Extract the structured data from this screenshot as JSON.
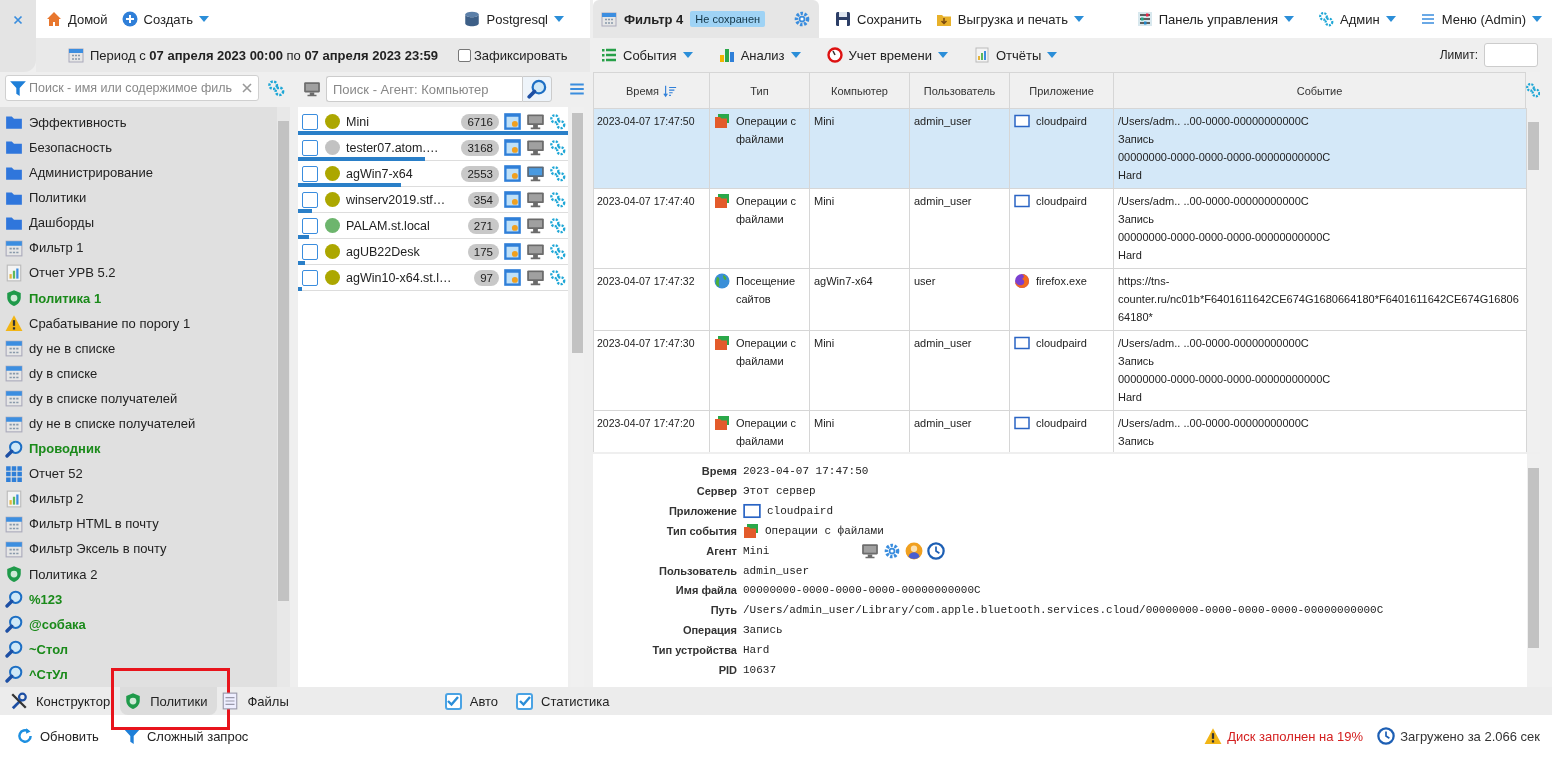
{
  "header": {
    "nav": [
      {
        "kind": "home",
        "label": "Домой",
        "dropdown": false
      },
      {
        "kind": "create",
        "label": "Создать",
        "dropdown": true
      }
    ],
    "database": {
      "label": "Postgresql",
      "dropdown": true
    },
    "period": {
      "text": "Период с **07 апреля 2023 00:00** по **07 апреля 2023 23:59**"
    },
    "fix_checkbox": {
      "label": "Зафиксировать",
      "checked": false
    },
    "document_tabs": [
      {
        "label": "Фильтр 4",
        "badge": "Не сохранен",
        "selected": true
      }
    ],
    "actions": [
      {
        "kind": "save",
        "label": "Сохранить",
        "dropdown": false
      },
      {
        "kind": "export",
        "label": "Выгрузка и печать",
        "dropdown": true
      }
    ],
    "menus": [
      {
        "kind": "panel",
        "label": "Панель управления",
        "dropdown": true
      },
      {
        "kind": "admin",
        "label": "Админ",
        "dropdown": true
      },
      {
        "kind": "menu",
        "label": "Меню (Admin)",
        "dropdown": true
      }
    ],
    "toolbar": [
      {
        "kind": "events",
        "label": "События",
        "dropdown": true
      },
      {
        "kind": "analysis",
        "label": "Анализ",
        "dropdown": true
      },
      {
        "kind": "time",
        "label": "Учет времени",
        "dropdown": true
      },
      {
        "kind": "reports",
        "label": "Отчёты",
        "dropdown": true
      }
    ],
    "limit": {
      "label": "Лимит:"
    }
  },
  "sidebar": {
    "search": {
      "placeholder": "Поиск - имя или содержимое филь"
    },
    "items": [
      {
        "kind": "folder",
        "label": "Эффективность",
        "emphasized": false
      },
      {
        "kind": "folder",
        "label": "Безопасность",
        "emphasized": false
      },
      {
        "kind": "folder",
        "label": "Администрирование",
        "emphasized": false
      },
      {
        "kind": "folder",
        "label": "Политики",
        "emphasized": false
      },
      {
        "kind": "folder",
        "label": "Дашборды",
        "emphasized": false
      },
      {
        "kind": "filter",
        "label": "Фильтр 1",
        "emphasized": false
      },
      {
        "kind": "report",
        "label": "Отчет УРВ 5.2",
        "emphasized": false
      },
      {
        "kind": "policy",
        "label": "Политика 1",
        "emphasized": true
      },
      {
        "kind": "alert",
        "label": "Срабатывание по порогу 1",
        "emphasized": false
      },
      {
        "kind": "filter",
        "label": "dy не в списке",
        "emphasized": false
      },
      {
        "kind": "filter",
        "label": "dy в списке",
        "emphasized": false
      },
      {
        "kind": "filter",
        "label": "dy в списке получателей",
        "emphasized": false
      },
      {
        "kind": "filter",
        "label": "dy не в списке получателей",
        "emphasized": false
      },
      {
        "kind": "search",
        "label": "Проводник",
        "emphasized": true
      },
      {
        "kind": "grid",
        "label": "Отчет 52",
        "emphasized": false
      },
      {
        "kind": "report",
        "label": "Фильтр 2",
        "emphasized": false
      },
      {
        "kind": "filter",
        "label": "Фильтр HTML в почту",
        "emphasized": false
      },
      {
        "kind": "filter",
        "label": "Фильтр Эксель в почту",
        "emphasized": false
      },
      {
        "kind": "policy",
        "label": "Политика 2",
        "emphasized": false
      },
      {
        "kind": "search",
        "label": "%123",
        "emphasized": true
      },
      {
        "kind": "search",
        "label": "@собака",
        "emphasized": true
      },
      {
        "kind": "search",
        "label": "~Стол",
        "emphasized": true
      },
      {
        "kind": "search",
        "label": "^СтУл",
        "emphasized": true
      }
    ]
  },
  "agents": {
    "search": {
      "placeholder": "Поиск - Агент: Компьютер"
    },
    "items": [
      {
        "name": "Mini",
        "count": "6716",
        "color": "#aca700",
        "checked": false,
        "level": 1,
        "monitor_active": false
      },
      {
        "name": "tester07.atom.…",
        "count": "3168",
        "color": "#c2c2c2",
        "checked": false,
        "level": 0.47,
        "monitor_active": false
      },
      {
        "name": "agWin7-x64",
        "count": "2553",
        "color": "#aca700",
        "checked": false,
        "level": 0.38,
        "monitor_active": true
      },
      {
        "name": "winserv2019.stf…",
        "count": "354",
        "color": "#aca700",
        "checked": false,
        "level": 0.05,
        "monitor_active": false
      },
      {
        "name": "PALAM.st.local",
        "count": "271",
        "color": "#6db56d",
        "checked": false,
        "level": 0.04,
        "monitor_active": false
      },
      {
        "name": "agUB22Desk",
        "count": "175",
        "color": "#aca700",
        "checked": false,
        "level": 0.025,
        "monitor_active": false
      },
      {
        "name": "agWin10-x64.st.l…",
        "count": "97",
        "color": "#aca700",
        "checked": false,
        "level": 0.015,
        "monitor_active": false
      }
    ]
  },
  "table": {
    "columns": [
      {
        "label": "Время",
        "sorted": true
      },
      {
        "label": "Тип",
        "sorted": false
      },
      {
        "label": "Компьютер",
        "sorted": false
      },
      {
        "label": "Пользователь",
        "sorted": false
      },
      {
        "label": "Приложение",
        "sorted": false
      },
      {
        "label": "Событие",
        "sorted": false
      }
    ],
    "rows": [
      {
        "selected": true,
        "time": "2023-04-07 17:47:50",
        "type": {
          "kind": "files",
          "text": "Операции с файлами"
        },
        "computer": "Mini",
        "user": "admin_user",
        "app": {
          "kind": "window",
          "text": "cloudpaird"
        },
        "event": [
          "/Users/adm.. ..00-0000-00000000000C",
          "Запись",
          "00000000-0000-0000-0000-00000000000C",
          "Hard"
        ]
      },
      {
        "selected": false,
        "time": "2023-04-07 17:47:40",
        "type": {
          "kind": "files",
          "text": "Операции с файлами"
        },
        "computer": "Mini",
        "user": "admin_user",
        "app": {
          "kind": "window",
          "text": "cloudpaird"
        },
        "event": [
          "/Users/adm.. ..00-0000-00000000000C",
          "Запись",
          "00000000-0000-0000-0000-00000000000C",
          "Hard"
        ]
      },
      {
        "selected": false,
        "time": "2023-04-07 17:47:32",
        "type": {
          "kind": "web",
          "text": "Посещение сайтов"
        },
        "computer": "agWin7-x64",
        "user": "user",
        "app": {
          "kind": "browser",
          "text": "firefox.exe"
        },
        "event": [
          "https://tns-counter.ru/nc01b*F6401611642CE674G1680664180*F6401611642CE674G1680664180*"
        ]
      },
      {
        "selected": false,
        "time": "2023-04-07 17:47:30",
        "type": {
          "kind": "files",
          "text": "Операции с файлами"
        },
        "computer": "Mini",
        "user": "admin_user",
        "app": {
          "kind": "window",
          "text": "cloudpaird"
        },
        "event": [
          "/Users/adm.. ..00-0000-00000000000C",
          "Запись",
          "00000000-0000-0000-0000-00000000000C",
          "Hard"
        ]
      },
      {
        "selected": false,
        "time": "2023-04-07 17:47:20",
        "type": {
          "kind": "files",
          "text": "Операции с файлами"
        },
        "computer": "Mini",
        "user": "admin_user",
        "app": {
          "kind": "window",
          "text": "cloudpaird"
        },
        "event": [
          "/Users/adm.. ..00-0000-00000000000C",
          "Запись"
        ]
      }
    ]
  },
  "details": [
    {
      "kind": "text",
      "label": "Время",
      "value": "2023-04-07 17:47:50"
    },
    {
      "kind": "text",
      "label": "Сервер",
      "value": "Этот сервер"
    },
    {
      "kind": "app",
      "label": "Приложение",
      "value": "cloudpaird"
    },
    {
      "kind": "event_type",
      "label": "Тип события",
      "value": "Операции с файлами"
    },
    {
      "kind": "agent",
      "label": "Агент",
      "value": "Mini"
    },
    {
      "kind": "text",
      "label": "Пользователь",
      "value": "admin_user"
    },
    {
      "kind": "text",
      "label": "Имя файла",
      "value": "00000000-0000-0000-0000-00000000000C"
    },
    {
      "kind": "text",
      "label": "Путь",
      "value": "/Users/admin_user/Library/com.apple.bluetooth.services.cloud/00000000-0000-0000-0000-00000000000C"
    },
    {
      "kind": "text",
      "label": "Операция",
      "value": "Запись"
    },
    {
      "kind": "text",
      "label": "Тип устройства",
      "value": "Hard"
    },
    {
      "kind": "text",
      "label": "PID",
      "value": "10637"
    }
  ],
  "bottom_tabs": [
    {
      "kind": "constructor",
      "label": "Конструктор",
      "selected": false,
      "highlighted": false
    },
    {
      "kind": "policies",
      "label": "Политики",
      "selected": true,
      "highlighted": true
    },
    {
      "kind": "files",
      "label": "Файлы",
      "selected": false,
      "highlighted": false
    }
  ],
  "toggles": [
    {
      "label": "Авто",
      "checked": true
    },
    {
      "label": "Статистика",
      "checked": true
    }
  ],
  "status_bar": {
    "actions": [
      {
        "kind": "refresh",
        "label": "Обновить"
      },
      {
        "kind": "query",
        "label": "Сложный запрос"
      }
    ],
    "messages": [
      {
        "kind": "warning",
        "text": "Диск заполнен на 19%"
      },
      {
        "kind": "info",
        "text": "Загружено за 2.066 сек"
      }
    ]
  }
}
